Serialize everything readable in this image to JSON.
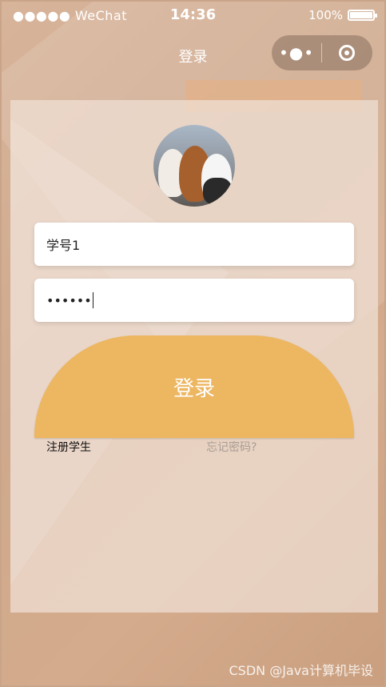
{
  "status_bar": {
    "carrier": "●●●●● WeChat",
    "time": "14:36",
    "battery_text": "100%",
    "battery_level": 1.0
  },
  "nav": {
    "title": "登录",
    "capsule_more_icon": "more-dots-icon",
    "capsule_close_icon": "target-icon"
  },
  "form": {
    "username_value": "学号1",
    "password_value": "••••••",
    "login_label": "登录",
    "register_link": "注册学生",
    "forgot_link": "忘记密码?"
  },
  "colors": {
    "button": "#edb660",
    "background": "#cfa98d"
  },
  "watermark": "CSDN @Java计算机毕设"
}
